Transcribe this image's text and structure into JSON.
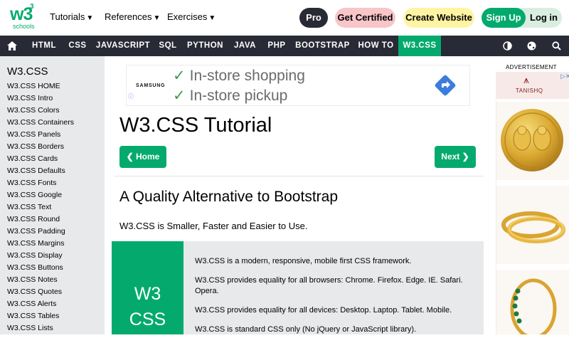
{
  "header": {
    "logo_main": "w3",
    "logo_sup": "3",
    "logo_sub": "schools",
    "menus": [
      "Tutorials",
      "References",
      "Exercises"
    ],
    "pro": "Pro",
    "get_certified": "Get Certified",
    "create_website": "Create Website",
    "sign_up": "Sign Up",
    "log_in": "Log in"
  },
  "nav": {
    "items": [
      "HTML",
      "CSS",
      "JAVASCRIPT",
      "SQL",
      "PYTHON",
      "JAVA",
      "PHP",
      "BOOTSTRAP",
      "HOW TO",
      "W3.CSS"
    ],
    "active": "W3.CSS"
  },
  "sidebar": {
    "title": "W3.CSS",
    "items": [
      "W3.CSS HOME",
      "W3.CSS Intro",
      "W3.CSS Colors",
      "W3.CSS Containers",
      "W3.CSS Panels",
      "W3.CSS Borders",
      "W3.CSS Cards",
      "W3.CSS Defaults",
      "W3.CSS Fonts",
      "W3.CSS Google",
      "W3.CSS Text",
      "W3.CSS Round",
      "W3.CSS Padding",
      "W3.CSS Margins",
      "W3.CSS Display",
      "W3.CSS Buttons",
      "W3.CSS Notes",
      "W3.CSS Quotes",
      "W3.CSS Alerts",
      "W3.CSS Tables",
      "W3.CSS Lists"
    ]
  },
  "ad_top": {
    "brand": "SAMSUNG",
    "line1": "In-store shopping",
    "line2": "In-store pickup"
  },
  "main": {
    "title": "W3.CSS Tutorial",
    "home_btn": "❮ Home",
    "next_btn": "Next ❯",
    "subtitle": "A Quality Alternative to Bootstrap",
    "lead": "W3.CSS is Smaller, Faster and Easier to Use.",
    "panel_badge_1": "W3",
    "panel_badge_2": "CSS",
    "panel_lines": [
      "W3.CSS is a modern, responsive, mobile first CSS framework.",
      "W3.CSS provides equality for all browsers: Chrome. Firefox. Edge. IE. Safari. Opera.",
      "W3.CSS provides equality for all devices: Desktop. Laptop. Tablet. Mobile.",
      "W3.CSS is standard CSS only (No jQuery or JavaScript library)."
    ]
  },
  "ad_right": {
    "label": "ADVERTISEMENT",
    "brand": "TANISHQ"
  },
  "colors": {
    "brand_green": "#04AA6D",
    "dark_nav": "#282A35",
    "sidebar_bg": "#E7E9EB",
    "pro_bg": "#282A35",
    "certified_bg": "#F8C5C9",
    "create_bg": "#FFF4A3"
  }
}
